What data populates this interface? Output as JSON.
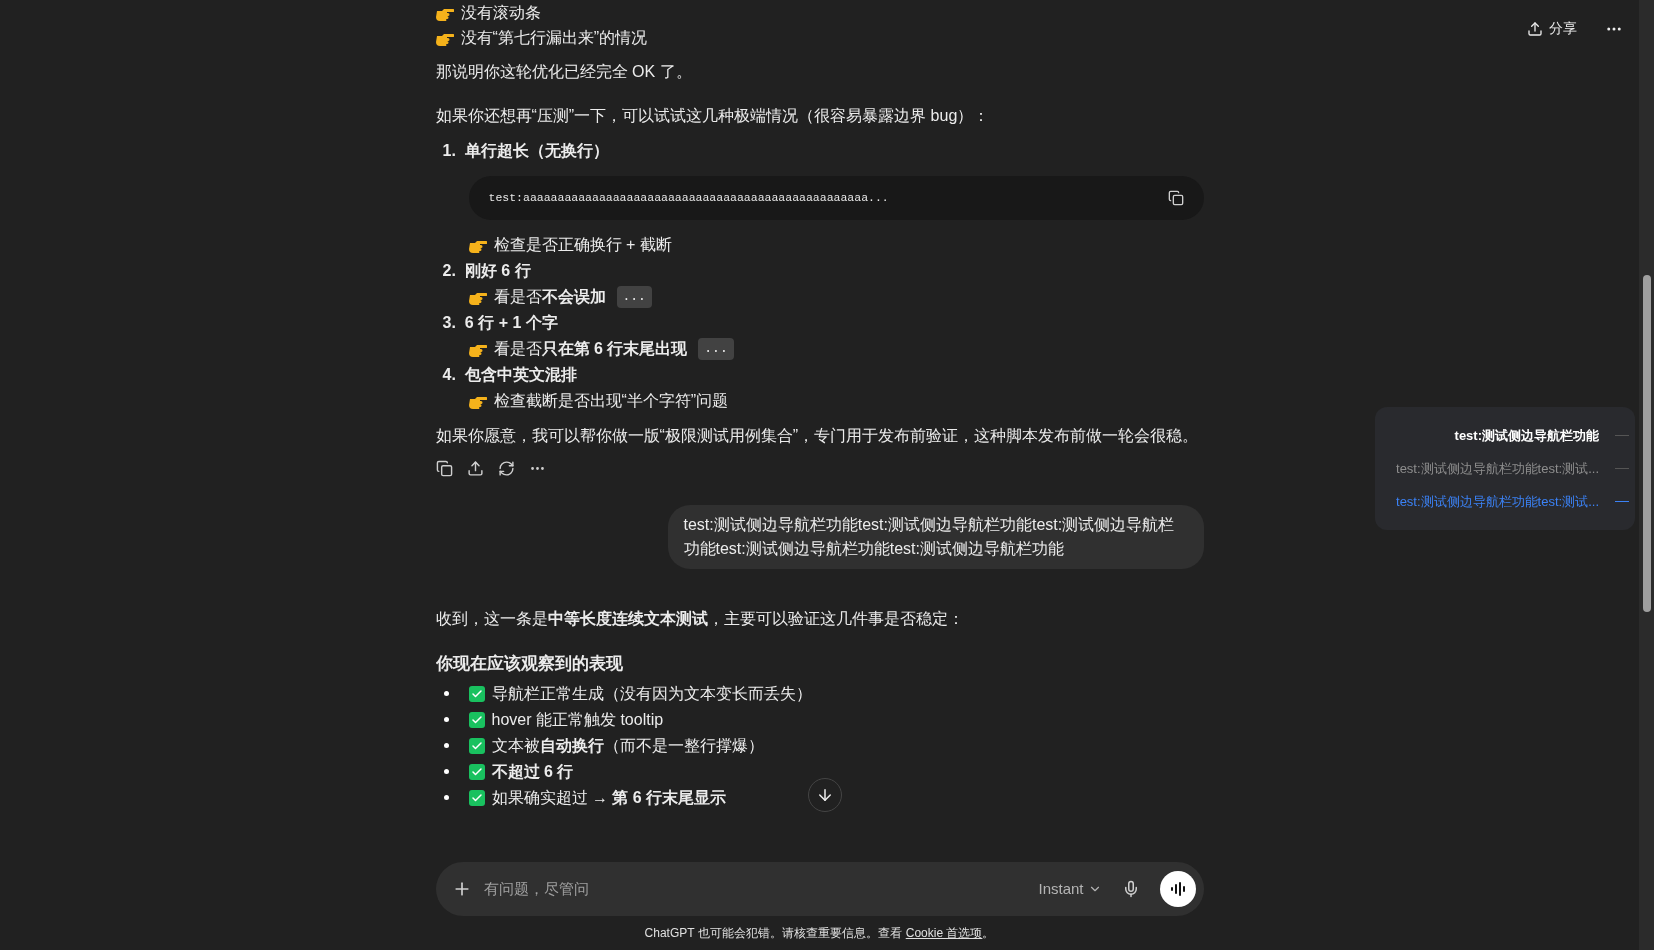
{
  "top_bar": {
    "share": "分享"
  },
  "thread": [
    {
      "kind": "assistant",
      "show_actions": true,
      "blocks": [
        {
          "kind": "pointer",
          "text": "没有滚动条"
        },
        {
          "kind": "pointer",
          "text": "没有“第七行漏出来”的情况"
        },
        {
          "kind": "paragraph",
          "text": "那说明你这轮优化已经完全 OK 了。"
        },
        {
          "kind": "paragraph",
          "text": "如果你还想再“压测”一下，可以试试这几种极端情况（很容易暴露边界 bug）："
        },
        {
          "kind": "ordered",
          "items": [
            {
              "number": "1.",
              "title": "单行超长（无换行）",
              "code_block": "test:aaaaaaaaaaaaaaaaaaaaaaaaaaaaaaaaaaaaaaaaaaaaaaaaaa...",
              "notes": [
                {
                  "text": "检查是否正确换行 + 截断"
                }
              ]
            },
            {
              "number": "2.",
              "title": "刚好 6 行",
              "notes": [
                {
                  "text": "看是否**不会误加**",
                  "code": "..."
                }
              ]
            },
            {
              "number": "3.",
              "title": "6 行 + 1 个字",
              "notes": [
                {
                  "text": "看是否**只在第 6 行末尾出现**",
                  "code": "..."
                }
              ]
            },
            {
              "number": "4.",
              "title": "包含中英文混排",
              "notes": [
                {
                  "text": "检查截断是否出现“半个字符”问题"
                }
              ]
            }
          ]
        },
        {
          "kind": "paragraph",
          "text": "如果你愿意，我可以帮你做一版“极限测试用例集合”，专门用于发布前验证，这种脚本发布前做一轮会很稳。"
        }
      ]
    },
    {
      "kind": "user",
      "text": "test:测试侧边导航栏功能test:测试侧边导航栏功能test:测试侧边导航栏功能test:测试侧边导航栏功能test:测试侧边导航栏功能"
    },
    {
      "kind": "assistant",
      "show_actions": false,
      "blocks": [
        {
          "kind": "paragraph",
          "text": "收到，这一条是**中等长度连续文本测试**，主要可以验证这几件事是否稳定："
        },
        {
          "kind": "heading",
          "text": "你现在应该观察到的表现"
        },
        {
          "kind": "checklist",
          "items": [
            {
              "text": "导航栏正常生成（没有因为文本变长而丢失）"
            },
            {
              "text": "hover 能正常触发 tooltip"
            },
            {
              "text": "文本被**自动换行**（而不是一整行撑爆）"
            },
            {
              "text": "**不超过 6 行**"
            },
            {
              "text": "如果确实超过 → **第 6 行末尾显示**"
            }
          ]
        }
      ]
    }
  ],
  "outline": [
    {
      "label": "test:测试侧边导航栏功能",
      "selected": false,
      "emphasized": true
    },
    {
      "label": "test:测试侧边导航栏功能test:测试...",
      "selected": false,
      "emphasized": false
    },
    {
      "label": "test:测试侧边导航栏功能test:测试...",
      "selected": true,
      "emphasized": false
    }
  ],
  "composer": {
    "placeholder": "有问题，尽管问",
    "model": "Instant"
  },
  "footer": {
    "text": "ChatGPT 也可能会犯错。请核查重要信息。查看",
    "link": "Cookie 首选项",
    "end": "。"
  }
}
